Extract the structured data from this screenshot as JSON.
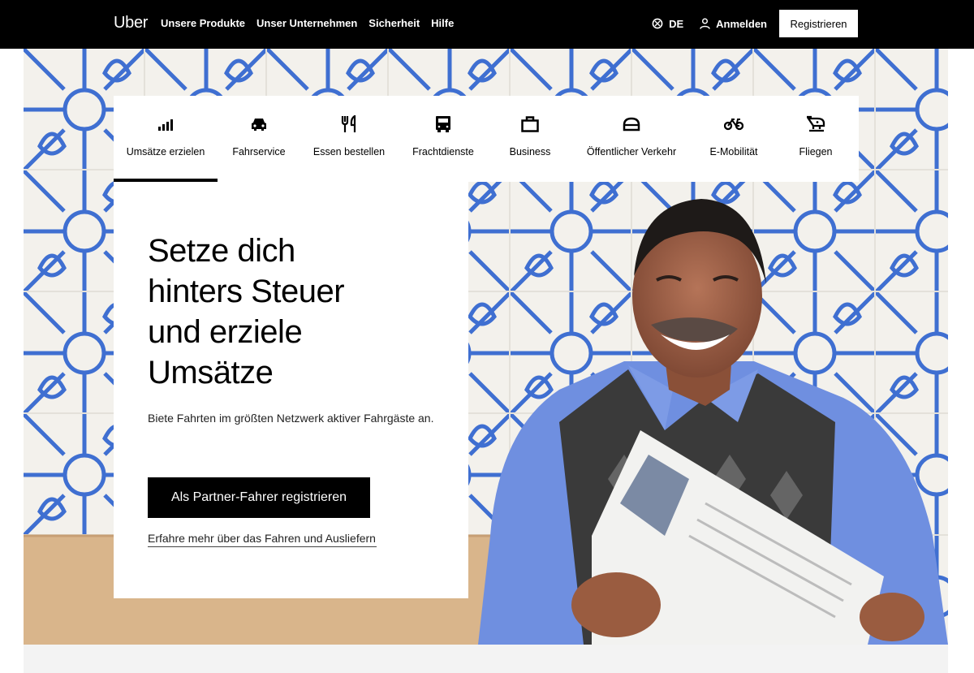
{
  "header": {
    "logo": "Uber",
    "nav": [
      "Unsere Produkte",
      "Unser Unternehmen",
      "Sicherheit",
      "Hilfe"
    ],
    "language": "DE",
    "login": "Anmelden",
    "register": "Registrieren"
  },
  "tabs": [
    {
      "label": "Umsätze erzielen",
      "icon": "bar-chart-icon",
      "active": true
    },
    {
      "label": "Fahrservice",
      "icon": "car-icon",
      "active": false
    },
    {
      "label": "Essen bestellen",
      "icon": "fork-knife-icon",
      "active": false
    },
    {
      "label": "Frachtdienste",
      "icon": "truck-icon",
      "active": false
    },
    {
      "label": "Business",
      "icon": "briefcase-icon",
      "active": false
    },
    {
      "label": "Öffentlicher Verkehr",
      "icon": "transit-icon",
      "active": false
    },
    {
      "label": "E-Mobilität",
      "icon": "bike-icon",
      "active": false
    },
    {
      "label": "Fliegen",
      "icon": "plane-icon",
      "active": false
    }
  ],
  "hero": {
    "headline_lines": [
      "Setze dich",
      "hinters Steuer",
      "und erziele",
      "Umsätze"
    ],
    "subtitle": "Biete Fahrten im größten Netzwerk aktiver Fahrgäste an.",
    "cta": "Als Partner-Fahrer registrieren",
    "learn_more": "Erfahre mehr über das Fahren und Ausliefern"
  },
  "colors": {
    "header_bg": "#000000",
    "pattern_blue": "#3f6fd1",
    "tile_bg": "#f3f1ec",
    "shirt_blue": "#6f8fe0"
  }
}
